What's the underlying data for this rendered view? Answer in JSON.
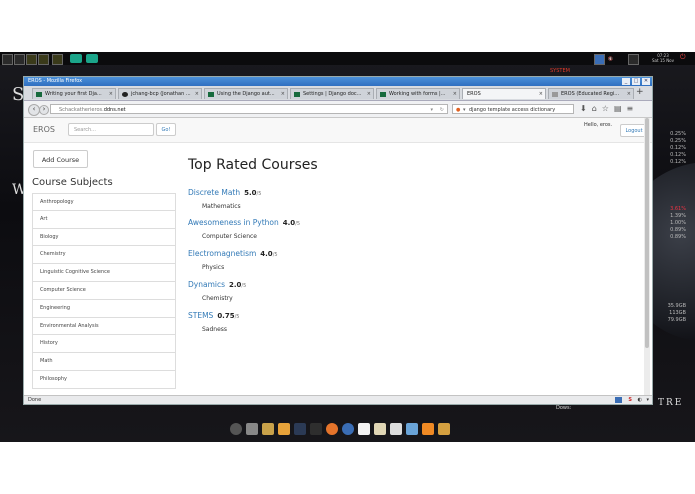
{
  "desktop": {
    "clock": "07:23",
    "date": "Sat 15 Nov",
    "system_label": "SYSTEM",
    "left_glyph": "S",
    "left_glyph_2": "W",
    "right_text": "TRE",
    "dows_label": "Dows:",
    "sysmon_top": [
      "0.25%",
      "0.25%",
      "0.12%",
      "0.12%",
      "0.12%"
    ],
    "sysmon_mid": [
      "3.61%",
      "1.39%",
      "1.00%",
      "0.89%",
      "0.89%"
    ],
    "sysmon_bottom": [
      "35.9GB",
      "113GB",
      "79.9GB"
    ]
  },
  "window": {
    "title": "EROS - Mozilla Firefox",
    "tabs": [
      {
        "label": "Writing your first Dja..."
      },
      {
        "label": "jchang-bcp (Jonathan ..."
      },
      {
        "label": "Using the Django aut..."
      },
      {
        "label": "Settings | Django doc..."
      },
      {
        "label": "Working with forms |..."
      },
      {
        "label": "EROS"
      },
      {
        "label": "EROS (Educated Regi..."
      }
    ],
    "url_prefix": "Schackatherieros.",
    "url_domain": "ddns.net",
    "search_value": "django template access dictionary",
    "status": "Done"
  },
  "site": {
    "brand": "EROS",
    "search_placeholder": "Search...",
    "go_label": "Go!",
    "greeting": "Hello, eros.",
    "logout_label": "Logout",
    "add_course_label": "Add Course",
    "subjects_heading": "Course Subjects",
    "subjects": [
      "Anthropology",
      "Art",
      "Biology",
      "Chemistry",
      "Linguistic Cognitive Science",
      "Computer Science",
      "Engineering",
      "Environmental Analysis",
      "History",
      "Math",
      "Philosophy"
    ],
    "main_heading": "Top Rated Courses",
    "courses": [
      {
        "name": "Discrete Math",
        "score": "5.0",
        "denom": "/5",
        "subject": "Mathematics"
      },
      {
        "name": "Awesomeness in Python",
        "score": "4.0",
        "denom": "/5",
        "subject": "Computer Science"
      },
      {
        "name": "Electromagnetism",
        "score": "4.0",
        "denom": "/5",
        "subject": "Physics"
      },
      {
        "name": "Dynamics",
        "score": "2.0",
        "denom": "/5",
        "subject": "Chemistry"
      },
      {
        "name": "STEMS",
        "score": "0.75",
        "denom": "/5",
        "subject": "Sadness"
      }
    ]
  }
}
